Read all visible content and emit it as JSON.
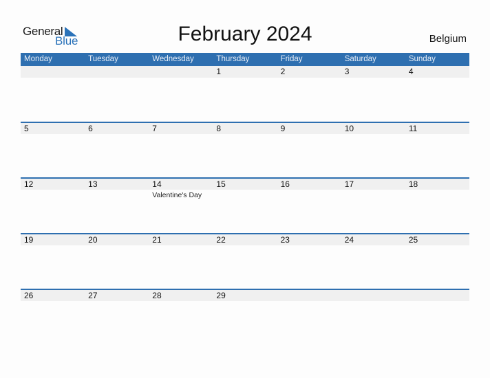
{
  "logo": {
    "text_general": "General",
    "text_blue": "Blue",
    "accent": "#2a72b9"
  },
  "title": "February 2024",
  "country": "Belgium",
  "colors": {
    "header_bg": "#2e6fb0",
    "band_bg": "#f0f0f0"
  },
  "weekdays": [
    "Monday",
    "Tuesday",
    "Wednesday",
    "Thursday",
    "Friday",
    "Saturday",
    "Sunday"
  ],
  "weeks": [
    [
      {
        "day": ""
      },
      {
        "day": ""
      },
      {
        "day": ""
      },
      {
        "day": "1"
      },
      {
        "day": "2"
      },
      {
        "day": "3"
      },
      {
        "day": "4"
      }
    ],
    [
      {
        "day": "5"
      },
      {
        "day": "6"
      },
      {
        "day": "7"
      },
      {
        "day": "8"
      },
      {
        "day": "9"
      },
      {
        "day": "10"
      },
      {
        "day": "11"
      }
    ],
    [
      {
        "day": "12"
      },
      {
        "day": "13"
      },
      {
        "day": "14",
        "holiday": "Valentine's Day"
      },
      {
        "day": "15"
      },
      {
        "day": "16"
      },
      {
        "day": "17"
      },
      {
        "day": "18"
      }
    ],
    [
      {
        "day": "19"
      },
      {
        "day": "20"
      },
      {
        "day": "21"
      },
      {
        "day": "22"
      },
      {
        "day": "23"
      },
      {
        "day": "24"
      },
      {
        "day": "25"
      }
    ],
    [
      {
        "day": "26"
      },
      {
        "day": "27"
      },
      {
        "day": "28"
      },
      {
        "day": "29"
      },
      {
        "day": ""
      },
      {
        "day": ""
      },
      {
        "day": ""
      }
    ]
  ]
}
